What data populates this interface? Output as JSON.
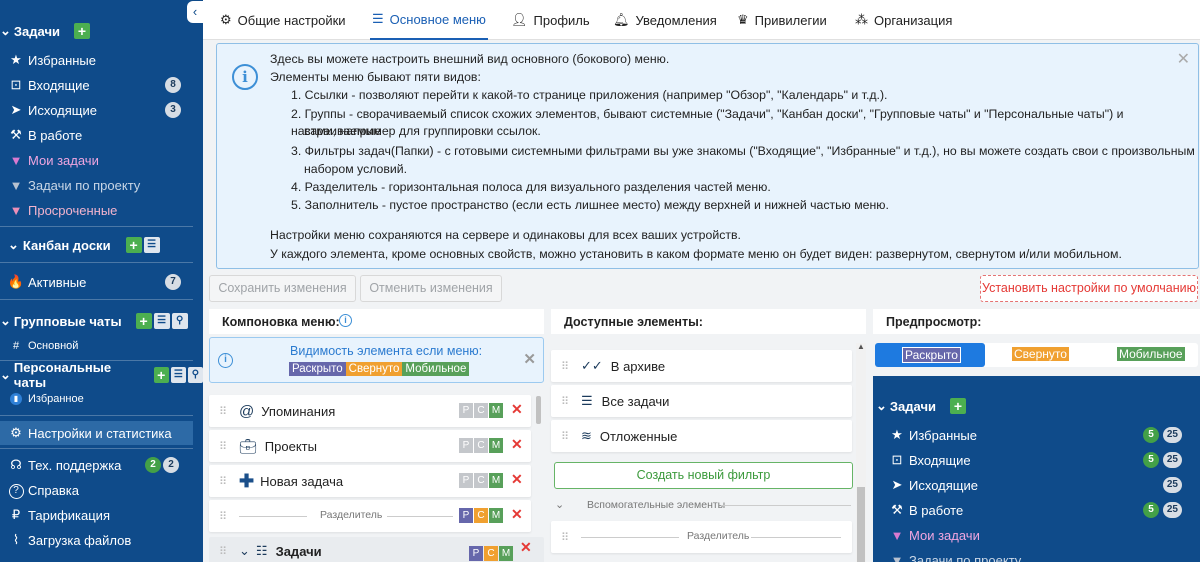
{
  "sidebar": {
    "sections": {
      "tasks": "Задачи",
      "kanban": "Канбан доски",
      "group_chats": "Групповые чаты",
      "personal_chats": "Персональные чаты"
    },
    "items": {
      "favorites": "Избранные",
      "inbox": "Входящие",
      "inbox_count": "8",
      "outgoing": "Исходящие",
      "outgoing_count": "3",
      "in_progress": "В работе",
      "my_tasks": "Мои задачи",
      "project_tasks": "Задачи по проекту",
      "overdue": "Просроченные",
      "active": "Активные",
      "active_count": "7",
      "main_chat": "Основной",
      "favorite_chat": "Избранное",
      "settings": "Настройки и статистика",
      "support": "Тех. поддержка",
      "support_count_a": "2",
      "support_count_b": "2",
      "help": "Справка",
      "billing": "Тарификация",
      "uploads": "Загрузка файлов"
    }
  },
  "tabs": [
    "Общие настройки",
    "Основное меню",
    "Профиль",
    "Уведомления",
    "Привилегии",
    "Организация"
  ],
  "info": {
    "line1": "Здесь вы можете настроить внешний вид основного (бокового) меню.",
    "line2": "Элементы меню бывают пяти видов:",
    "li1": "1. Ссылки - позволяют перейти к какой-то странице приложения (например \"Обзор\", \"Календарь\" и т.д.).",
    "li2a": "2. Группы - сворачиваемый список схожих элементов, бывают системные (\"Задачи\", \"Канбан доски\", \"Групповые чаты\" и \"Персональные чаты\") и настраиваемые",
    "li2b": "вами, например для группировки ссылок.",
    "li3a": "3. Фильтры задач(Папки) - с готовыми системными фильтрами вы уже знакомы (\"Входящие\", \"Избранные\" и т.д.), но вы можете создать свои с произвольным",
    "li3b": "набором условий.",
    "li4": "4. Разделитель - горизонтальная полоса для визуального разделения частей меню.",
    "li5": "5. Заполнитель - пустое пространство (если есть лишнее место) между верхней и нижней частью меню.",
    "foot1": "Настройки меню сохраняются на сервере и одинаковы для всех ваших устройств.",
    "foot2": "У каждого элемента, кроме основных свойств, можно установить в каком формате меню он будет виден: развернутом, свернутом и/или мобильном."
  },
  "buttons": {
    "save": "Сохранить изменения",
    "cancel": "Отменить изменения",
    "reset": "Установить настройки по умолчанию"
  },
  "layout_panel": {
    "title": "Компоновка меню:",
    "visibility_label": "Видимость элемента если меню:",
    "tag_expanded": "Раскрыто",
    "tag_collapsed": "Свернуто",
    "tag_mobile": "Мобильное",
    "rows": {
      "mentions": "Упоминания",
      "projects": "Проекты",
      "new_task": "Новая задача",
      "separator": "Разделитель",
      "tasks": "Задачи"
    },
    "p": "P",
    "c": "C",
    "m": "M"
  },
  "available_panel": {
    "title": "Доступные элементы:",
    "archive": "В архиве",
    "all_tasks": "Все задачи",
    "postponed": "Отложенные",
    "create_filter": "Создать новый фильтр",
    "aux_section": "Вспомогательные элементы",
    "separator": "Разделитель"
  },
  "preview_panel": {
    "title": "Предпросмотр:",
    "mode_expanded": "Раскрыто",
    "mode_collapsed": "Свернуто",
    "mode_mobile": "Мобильное",
    "section_tasks": "Задачи",
    "favorites": "Избранные",
    "inbox": "Входящие",
    "outgoing": "Исходящие",
    "in_progress": "В работе",
    "my_tasks": "Мои задачи",
    "project_tasks": "Задачи по проекту",
    "n5": "5",
    "n25": "25"
  },
  "colors": {
    "sidebar_bg": "#0f4b8a",
    "accent": "#1a5fb4",
    "green": "#4caf50",
    "danger": "#e53935",
    "expanded_tag": "#6667ab",
    "collapsed_tag": "#f0a030",
    "mobile_tag": "#58a05a"
  }
}
